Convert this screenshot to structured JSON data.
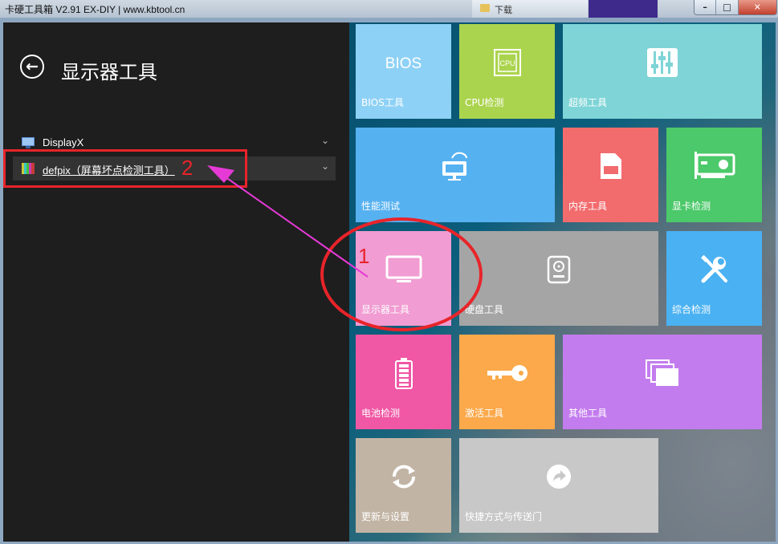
{
  "window": {
    "title": "卡硬工具箱 V2.91  EX-DIY  | www.kbtool.cn",
    "bg_tab": "下载"
  },
  "left": {
    "page_title": "显示器工具",
    "items": [
      {
        "label": "DisplayX"
      },
      {
        "label": "defpix（屏幕坏点检测工具）"
      }
    ]
  },
  "tiles": [
    {
      "label": "BIOS工具",
      "icon_text": "BIOS",
      "color": "#8ed1f6"
    },
    {
      "label": "CPU检测",
      "icon_text": "CPU",
      "color": "#abd44e"
    },
    {
      "label": "超频工具",
      "color": "#7ed4d6"
    },
    {
      "label": "性能测试",
      "color": "#56b1f1"
    },
    {
      "label": "内存工具",
      "color": "#f26b6d"
    },
    {
      "label": "显卡检测",
      "color": "#4cc96a"
    },
    {
      "label": "显示器工具",
      "color": "#f19cd2"
    },
    {
      "label": "硬盘工具",
      "color": "#a5a5a5"
    },
    {
      "label": "综合检测",
      "color": "#4ab1f2"
    },
    {
      "label": "电池检测",
      "color": "#f057a4"
    },
    {
      "label": "激活工具",
      "color": "#fba94b"
    },
    {
      "label": "其他工具",
      "color": "#c37cee"
    },
    {
      "label": "更新与设置",
      "color": "#c2b4a4"
    },
    {
      "label": "快捷方式与传送门",
      "color": "#c8c8c8"
    }
  ],
  "annotations": {
    "num1": "1",
    "num2": "2",
    "color_red": "#e8242a",
    "color_arrow": "#e63ad7"
  }
}
